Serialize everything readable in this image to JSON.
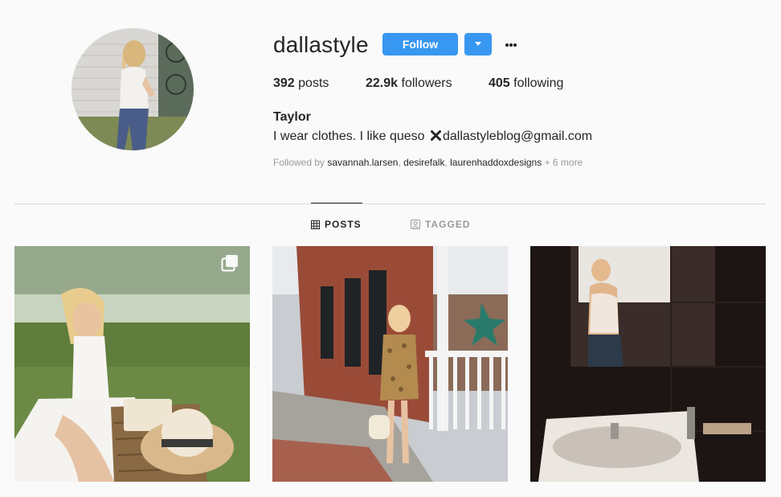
{
  "profile": {
    "username": "dallastyle",
    "follow_label": "Follow",
    "stats": {
      "posts_count": "392",
      "posts_label": " posts",
      "followers_count": "22.9k",
      "followers_label": " followers",
      "following_count": "405",
      "following_label": " following"
    },
    "full_name": "Taylor",
    "bio_text": "I wear clothes. I like queso ",
    "bio_email": "dallastyleblog@gmail.com",
    "followed_by": {
      "prefix": "Followed by ",
      "users": [
        "savannah.larsen",
        "desirefalk",
        "laurenhaddoxdesigns"
      ],
      "separator": ", ",
      "more": " + 6 more"
    }
  },
  "tabs": [
    {
      "label": "POSTS",
      "icon": "grid-icon",
      "active": true
    },
    {
      "label": "TAGGED",
      "icon": "tagged-person-icon",
      "active": false
    }
  ],
  "posts": [
    {
      "icon": "multiple-photos-icon"
    },
    {},
    {}
  ],
  "colors": {
    "accent": "#3897f0",
    "text": "#262626",
    "muted": "#999999",
    "background": "#fafafa",
    "divider": "#dbdbdb"
  }
}
